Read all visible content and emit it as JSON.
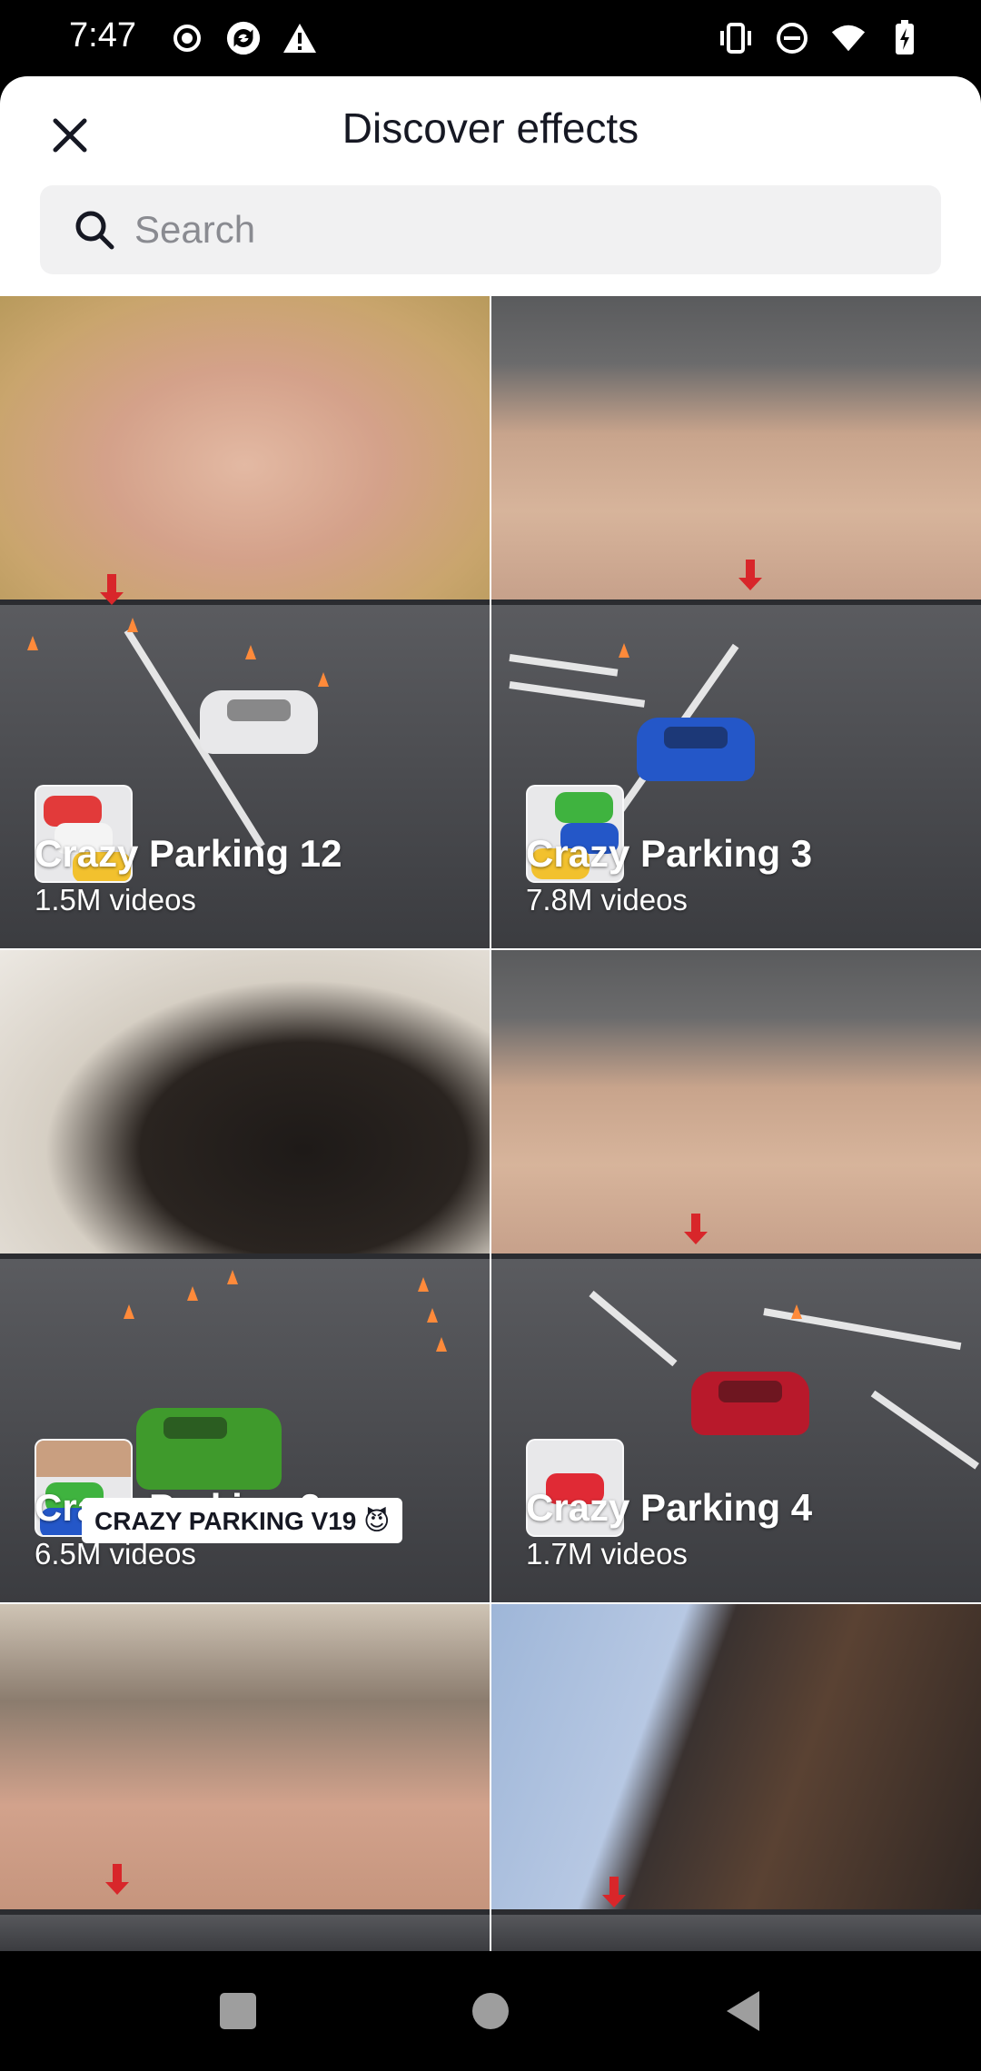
{
  "status_bar": {
    "time": "7:47",
    "left_icons": [
      "record-icon",
      "sync-icon",
      "warning-icon"
    ],
    "right_icons": [
      "vibrate-icon",
      "do-not-disturb-icon",
      "wifi-icon",
      "battery-icon"
    ]
  },
  "header": {
    "title": "Discover effects",
    "close_icon": "close-icon"
  },
  "search": {
    "placeholder": "Search",
    "value": "",
    "icon": "search-icon"
  },
  "effects": [
    {
      "name": "Crazy Parking 12",
      "count": "1.5M videos"
    },
    {
      "name": "Crazy Parking 3",
      "count": "7.8M videos"
    },
    {
      "name": "Crazy Parking 2",
      "count": "6.5M videos"
    },
    {
      "name": "Crazy Parking 4",
      "count": "1.7M videos"
    },
    {
      "name": "",
      "count": "",
      "overlay_text": "CRAZY PARKING V19 😈"
    },
    {
      "name": "",
      "count": ""
    }
  ],
  "nav_bar": {
    "buttons": [
      "recents-button",
      "home-button",
      "back-button"
    ]
  },
  "colors": {
    "sheet_bg": "#ffffff",
    "search_bg": "#f1f1f2",
    "title_text": "#161823",
    "placeholder_text": "#8a8b91"
  }
}
